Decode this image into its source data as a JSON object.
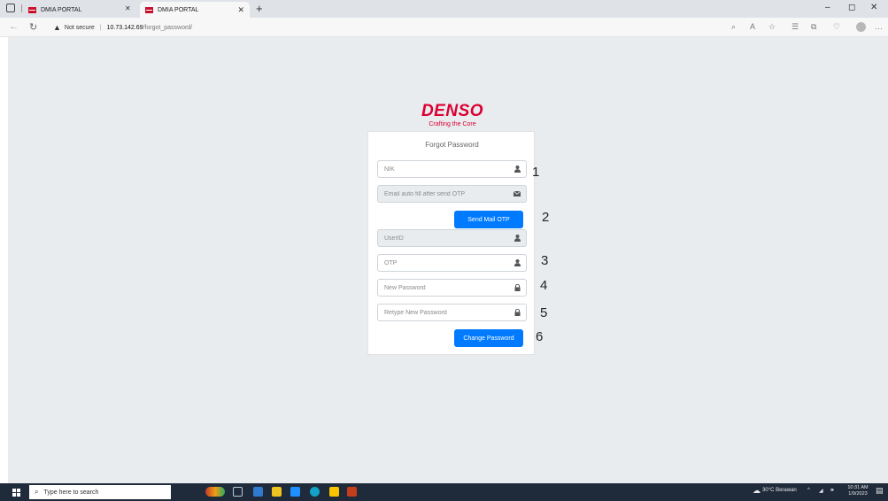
{
  "browser": {
    "tabs": [
      {
        "label": "DMIA PORTAL",
        "active": false
      },
      {
        "label": "DMIA PORTAL",
        "active": true
      }
    ],
    "new_tab_label": "+",
    "security_label": "Not secure",
    "url_host": "10.73.142.69",
    "url_path": "/forgot_password/",
    "window_controls": {
      "minimize": "–",
      "maximize": "◻",
      "close": "✕"
    },
    "icons": [
      "back-arrow-icon",
      "refresh-icon",
      "warning-icon",
      "zoom-icon",
      "read-aloud-icon",
      "favorites-icon",
      "collections-icon",
      "browser-essentials-icon",
      "profile-icon",
      "more-icon"
    ]
  },
  "logo": {
    "brand": "DENSO",
    "tagline": "Crafting the Core",
    "color": "#dc0032"
  },
  "form": {
    "title": "Forgot Password",
    "fields": {
      "nik": {
        "placeholder": "NIK",
        "icon": "user-icon"
      },
      "email": {
        "placeholder": "Email auto fill after send OTP",
        "icon": "envelope-icon",
        "readonly": true
      },
      "userid": {
        "placeholder": "UserID",
        "icon": "user-icon",
        "readonly": true
      },
      "otp": {
        "placeholder": "OTP",
        "icon": "user-icon"
      },
      "new_password": {
        "placeholder": "New Password",
        "icon": "lock-icon"
      },
      "retype_password": {
        "placeholder": "Retype New Password",
        "icon": "lock-icon"
      }
    },
    "send_otp_label": "Send Mail OTP",
    "change_password_label": "Change Password",
    "accent_color": "#007bff"
  },
  "annotations": [
    "1",
    "2",
    "3",
    "4",
    "5",
    "6"
  ],
  "taskbar": {
    "search_placeholder": "Type here to search",
    "weather": "30°C Berawan",
    "time": "10:31 AM",
    "date": "1/9/2023"
  }
}
